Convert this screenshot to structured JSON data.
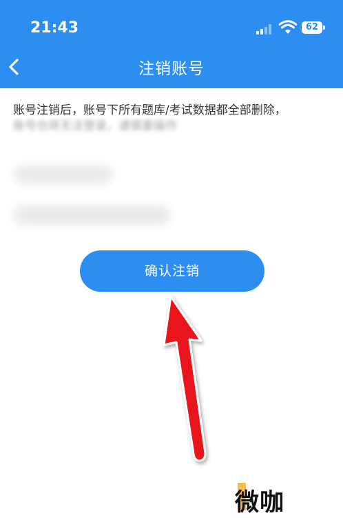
{
  "status_bar": {
    "time": "21:43",
    "battery": "62"
  },
  "nav": {
    "back_icon": "chevron-left-icon",
    "title": "注销账号"
  },
  "content": {
    "notice": "账号注销后，账号下所有题库/考试数据都全部删除，",
    "notice_line2": "账号也将无法登录，请慎重操作"
  },
  "confirm_button": {
    "label": "确认注销"
  },
  "watermark": {
    "text": "微咖"
  },
  "colors": {
    "brand": "#2c8ef0",
    "arrow": "#e8131b"
  }
}
